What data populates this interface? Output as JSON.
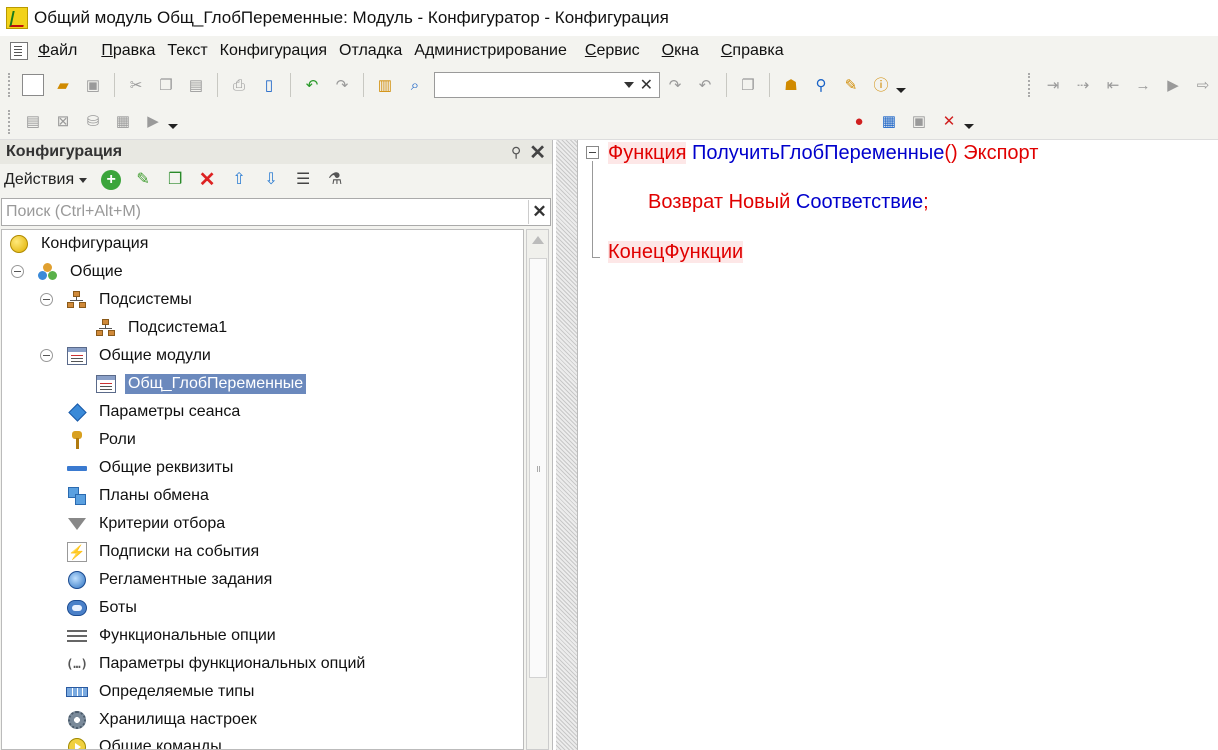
{
  "window": {
    "title": "Общий модуль Общ_ГлобПеременные: Модуль - Конфигуратор - Конфигурация"
  },
  "menu": {
    "items": [
      "Файл",
      "Правка",
      "Текст",
      "Конфигурация",
      "Отладка",
      "Администрирование",
      "Сервис",
      "Окна",
      "Справка"
    ]
  },
  "toolbar": {
    "search_value": ""
  },
  "config_panel": {
    "title": "Конфигурация",
    "actions_label": "Действия",
    "search_placeholder": "Поиск (Ctrl+Alt+M)",
    "search_value": ""
  },
  "tree": {
    "items": [
      {
        "label": "Конфигурация",
        "icon": "configuration-icon"
      },
      {
        "label": "Общие",
        "icon": "common-icon"
      },
      {
        "label": "Подсистемы",
        "icon": "subsystems-icon"
      },
      {
        "label": "Подсистема1",
        "icon": "subsystem-icon"
      },
      {
        "label": "Общие модули",
        "icon": "common-modules-icon"
      },
      {
        "label": "Общ_ГлобПеременные",
        "icon": "module-icon",
        "selected": true
      },
      {
        "label": "Параметры сеанса",
        "icon": "session-params-icon"
      },
      {
        "label": "Роли",
        "icon": "roles-icon"
      },
      {
        "label": "Общие реквизиты",
        "icon": "common-attributes-icon"
      },
      {
        "label": "Планы обмена",
        "icon": "exchange-plans-icon"
      },
      {
        "label": "Критерии отбора",
        "icon": "filter-criteria-icon"
      },
      {
        "label": "Подписки на события",
        "icon": "event-subscriptions-icon"
      },
      {
        "label": "Регламентные задания",
        "icon": "scheduled-jobs-icon"
      },
      {
        "label": "Боты",
        "icon": "bots-icon"
      },
      {
        "label": "Функциональные опции",
        "icon": "functional-options-icon"
      },
      {
        "label": "Параметры функциональных опций",
        "icon": "functional-option-params-icon"
      },
      {
        "label": "Определяемые типы",
        "icon": "defined-types-icon"
      },
      {
        "label": "Хранилища настроек",
        "icon": "settings-storages-icon"
      },
      {
        "label": "Общие команды",
        "icon": "common-commands-icon"
      }
    ]
  },
  "code": {
    "line1": {
      "kw": "Функция",
      "name": "ПолучитьГлобПеременные",
      "parens": "()",
      "export": "Экспорт"
    },
    "line2": {
      "kw1": "Возврат",
      "kw2": "Новый",
      "type": "Соответствие",
      "semi": ";"
    },
    "line3": {
      "kw": "КонецФункции"
    }
  },
  "colors": {
    "keyword": "#e00000",
    "identifier": "#0000cc",
    "selection": "#6b89bd",
    "chrome": "#f3f3ef"
  }
}
